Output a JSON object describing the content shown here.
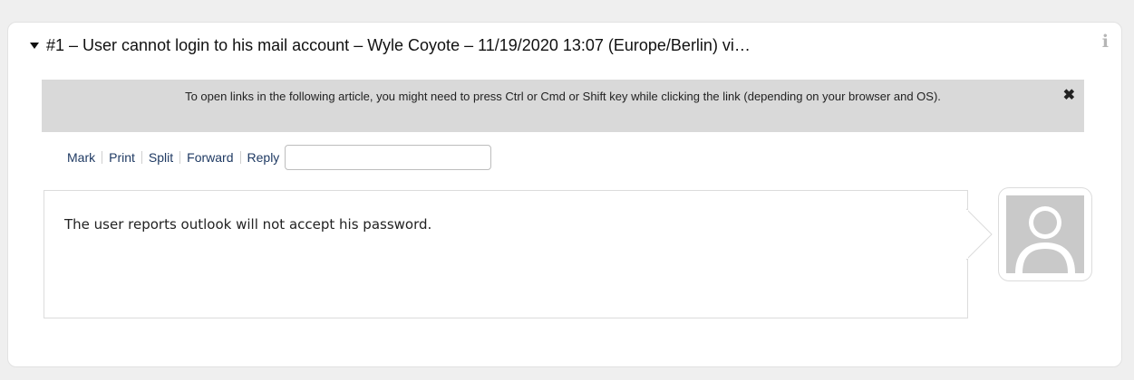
{
  "article": {
    "header_title": "#1 – User cannot login to his mail account – Wyle Coyote – 11/19/2020 13:07 (Europe/Berlin) vi…",
    "info_icon": "i"
  },
  "notice": {
    "text": "To open links in the following article, you might need to press Ctrl or Cmd or Shift key while clicking the link (depending on your browser and OS).",
    "close_icon": "✖"
  },
  "actions": {
    "mark": "Mark",
    "print": "Print",
    "split": "Split",
    "forward": "Forward",
    "reply": "Reply",
    "reply_select_value": ""
  },
  "body": {
    "text": "The user reports outlook will not accept his password."
  },
  "colors": {
    "link": "#1f3a63",
    "notice_bg": "#d9d9d9",
    "avatar_bg": "#c9c9c9"
  }
}
